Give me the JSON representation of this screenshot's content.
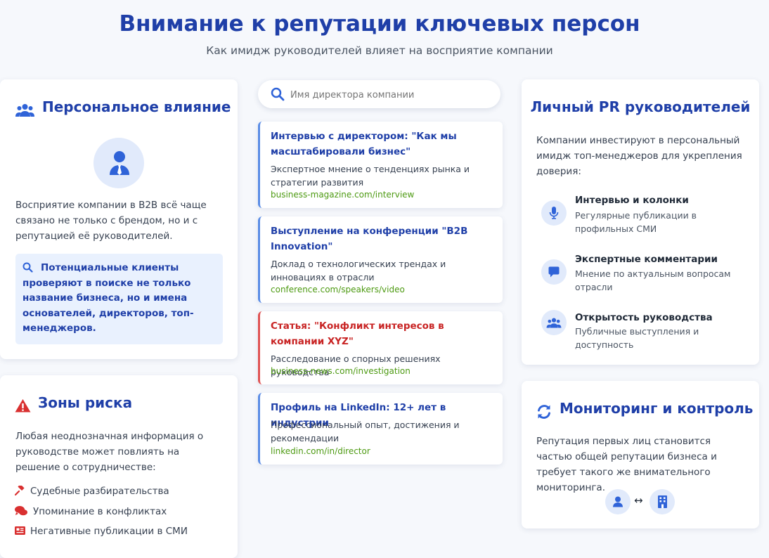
{
  "header": {
    "title": "Внимание к репутации ключевых персон",
    "subtitle": "Как имидж руководителей влияет на восприятие компании"
  },
  "influence": {
    "title": "Персональное влияние",
    "text": "Восприятие компании в B2B всё чаще связано не только с брендом, но и с репутацией её руководителей.",
    "highlight": "Потенциальные клиенты проверяют в поиске не только название бизнеса, но и имена основателей, директоров, топ-менеджеров."
  },
  "risk": {
    "title": "Зоны риска",
    "text": "Любая неоднозначная информация о руководстве может повлиять на решение о сотрудничестве:",
    "items": [
      {
        "label": "Судебные разбирательства",
        "icon": "gavel-icon"
      },
      {
        "label": "Упоминание в конфликтах",
        "icon": "comments-icon"
      },
      {
        "label": "Негативные публикации в СМИ",
        "icon": "newspaper-icon"
      }
    ]
  },
  "search": {
    "placeholder": "Имя директора компании"
  },
  "results": [
    {
      "title": "Интервью с директором: \"Как мы масштабировали бизнес\"",
      "desc": "Экспертное мнение о тенденциях рынка и стратегии развития",
      "url": "business-magazine.com/interview",
      "negative": false
    },
    {
      "title": "Выступление на конференции \"B2B Innovation\"",
      "desc": "Доклад о технологических трендах и инновациях в отрасли",
      "url": "conference.com/speakers/video",
      "negative": false
    },
    {
      "title": "Статья: \"Конфликт интересов в компании XYZ\"",
      "desc": "Расследование о спорных решениях руководства",
      "url": "business-news.com/investigation",
      "negative": true
    },
    {
      "title": "Профиль на LinkedIn: 12+ лет в индустрии",
      "desc": "Профессиональный опыт, достижения и рекомендации",
      "url": "linkedin.com/in/director",
      "negative": false
    }
  ],
  "pr": {
    "title": "Личный PR руководителей",
    "text": "Компании инвестируют в персональный имидж топ-менеджеров для укрепления доверия:",
    "items": [
      {
        "title": "Интервью и колонки",
        "desc": "Регулярные публикации в профильных СМИ",
        "icon": "microphone-icon"
      },
      {
        "title": "Экспертные комментарии",
        "desc": "Мнение по актуальным вопросам отрасли",
        "icon": "comment-icon"
      },
      {
        "title": "Открытость руководства",
        "desc": "Публичные выступления и доступность",
        "icon": "users-icon"
      }
    ]
  },
  "monitoring": {
    "title": "Мониторинг и контроль",
    "text": "Репутация первых лиц становится частью общей репутации бизнеса и требует такого же внимательного мониторинга.",
    "arrow": "↔"
  },
  "colors": {
    "accent": "#1f3fa8",
    "icon_blue": "#2f63d8",
    "danger": "#d93030",
    "url_green": "#4d9a12"
  }
}
